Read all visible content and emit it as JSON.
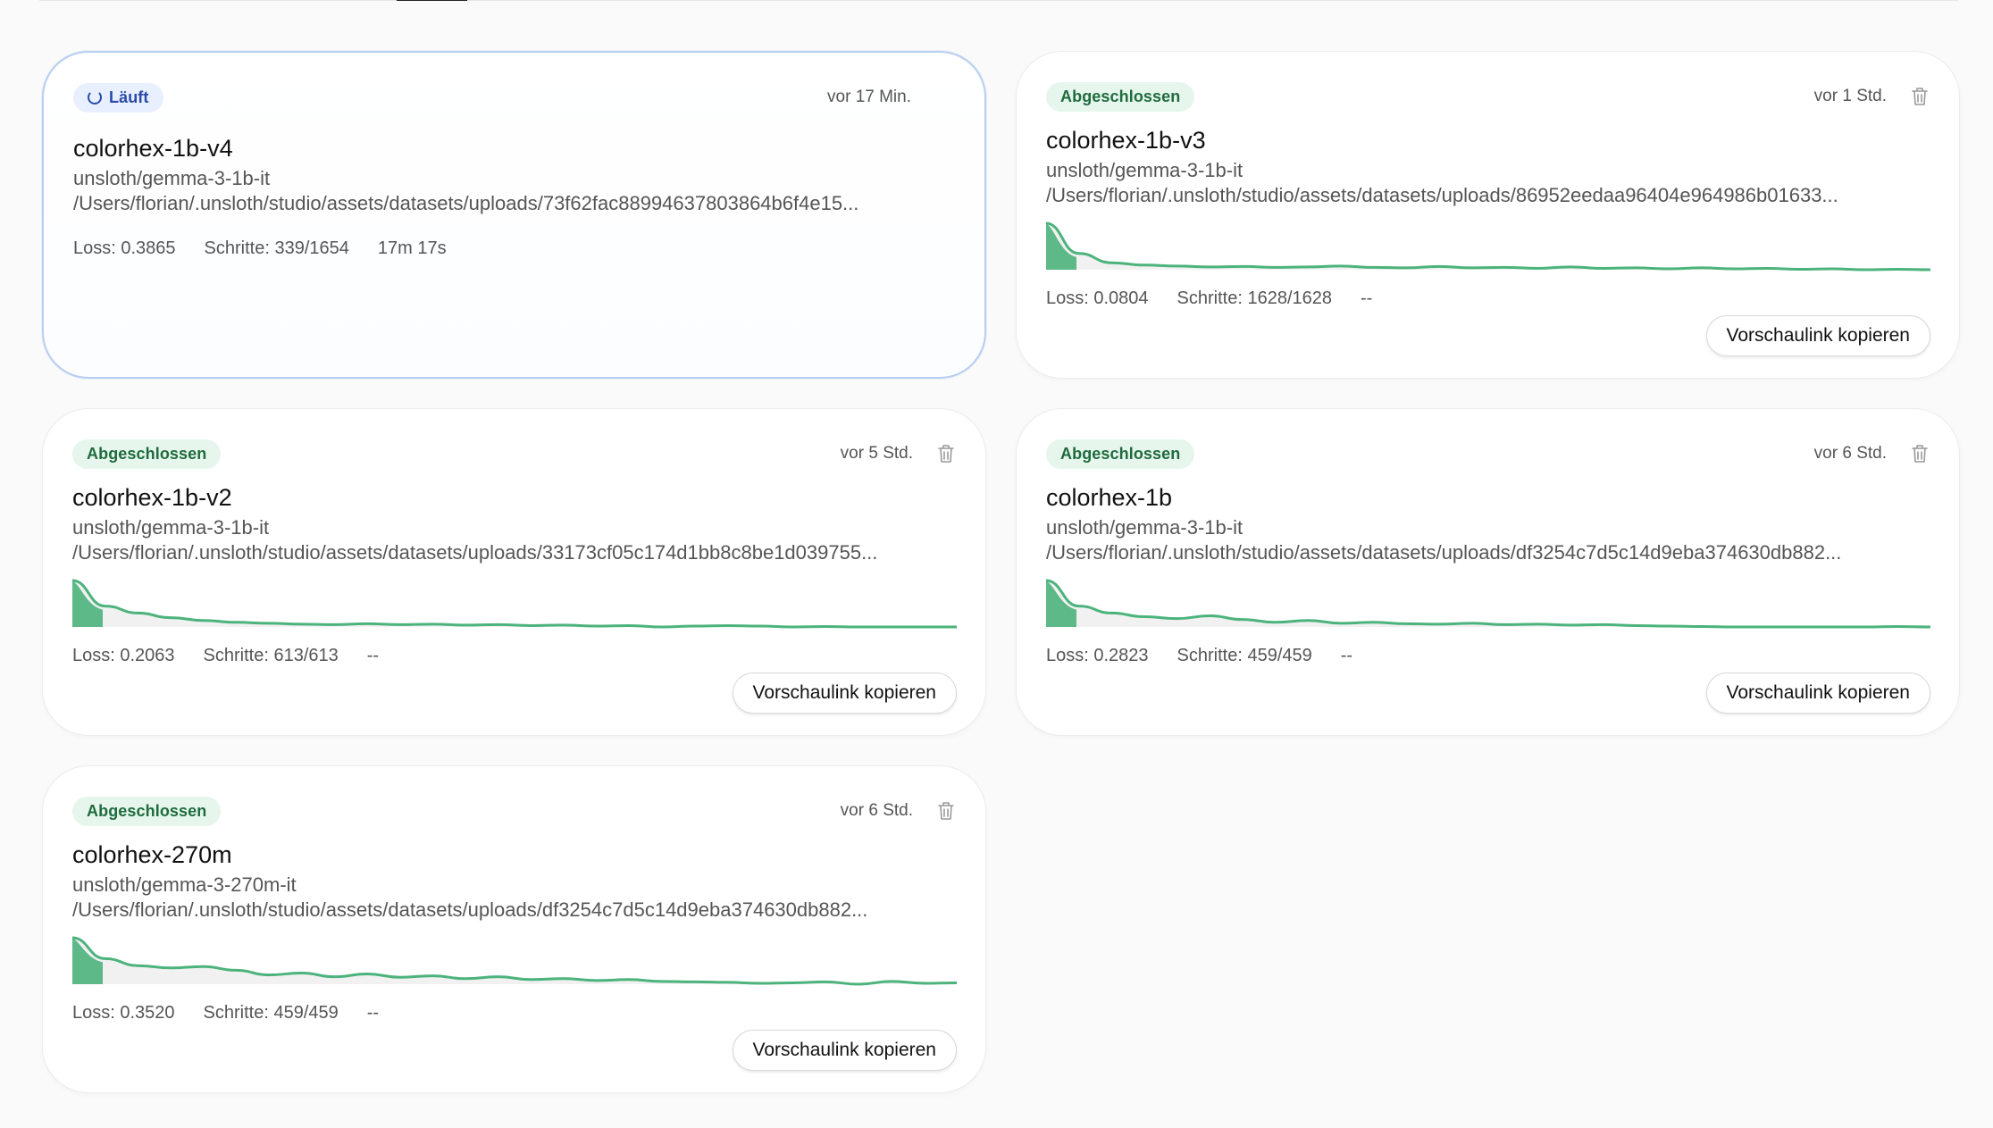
{
  "colors": {
    "accent_green": "#4cb37c",
    "badge_done_bg": "#e6f6ec",
    "badge_run_bg": "#e8efff",
    "running_border": "#b8cef0"
  },
  "labels": {
    "copy_button": "Vorschaulink kopieren",
    "loss_prefix": "Loss: ",
    "steps_prefix": "Schritte: "
  },
  "icons": {
    "trash": "trash-icon",
    "spinner": "spinner-icon"
  },
  "runs": [
    {
      "status": "Läuft",
      "time": "vor 17 Min.",
      "name": "colorhex-1b-v4",
      "model": "unsloth/gemma-3-1b-it",
      "dataset": "/Users/florian/.unsloth/studio/assets/datasets/uploads/73f62fac88994637803864b6f4e15...",
      "loss": "Loss: 0.3865",
      "steps": "Schritte: 339/1654",
      "duration": "17m 17s"
    },
    {
      "status": "Abgeschlossen",
      "time": "vor 1 Std.",
      "name": "colorhex-1b-v3",
      "model": "unsloth/gemma-3-1b-it",
      "dataset": "/Users/florian/.unsloth/studio/assets/datasets/uploads/86952eedaa96404e964986b01633...",
      "loss": "Loss: 0.0804",
      "steps": "Schritte: 1628/1628",
      "duration": "--",
      "loss_curve": [
        1.0,
        0.35,
        0.15,
        0.1,
        0.08,
        0.06,
        0.07,
        0.05,
        0.06,
        0.08,
        0.05,
        0.04,
        0.07,
        0.04,
        0.05,
        0.03,
        0.06,
        0.03,
        0.04,
        0.02,
        0.04,
        0.02,
        0.03,
        0.01,
        0.02,
        0.0,
        0.01,
        0.0
      ]
    },
    {
      "status": "Abgeschlossen",
      "time": "vor 5 Std.",
      "name": "colorhex-1b-v2",
      "model": "unsloth/gemma-3-1b-it",
      "dataset": "/Users/florian/.unsloth/studio/assets/datasets/uploads/33173cf05c174d1bb8c8be1d039755...",
      "loss": "Loss: 0.2063",
      "steps": "Schritte: 613/613",
      "duration": "--",
      "loss_curve": [
        1.0,
        0.45,
        0.3,
        0.2,
        0.14,
        0.1,
        0.08,
        0.06,
        0.05,
        0.07,
        0.05,
        0.06,
        0.04,
        0.05,
        0.03,
        0.04,
        0.02,
        0.03,
        0.0,
        0.02,
        0.03,
        0.02,
        0.0,
        0.01,
        0.0,
        0.0,
        0.0,
        0.0
      ]
    },
    {
      "status": "Abgeschlossen",
      "time": "vor 6 Std.",
      "name": "colorhex-1b",
      "model": "unsloth/gemma-3-1b-it",
      "dataset": "/Users/florian/.unsloth/studio/assets/datasets/uploads/df3254c7d5c14d9eba374630db882...",
      "loss": "Loss: 0.2823",
      "steps": "Schritte: 459/459",
      "duration": "--",
      "loss_curve": [
        1.0,
        0.45,
        0.3,
        0.22,
        0.18,
        0.24,
        0.16,
        0.1,
        0.14,
        0.08,
        0.1,
        0.07,
        0.06,
        0.08,
        0.05,
        0.06,
        0.04,
        0.05,
        0.03,
        0.02,
        0.01,
        0.0,
        0.0,
        0.0,
        0.0,
        0.0,
        0.01,
        0.0
      ]
    },
    {
      "status": "Abgeschlossen",
      "time": "vor 6 Std.",
      "name": "colorhex-270m",
      "model": "unsloth/gemma-3-270m-it",
      "dataset": "/Users/florian/.unsloth/studio/assets/datasets/uploads/df3254c7d5c14d9eba374630db882...",
      "loss": "Loss: 0.3520",
      "steps": "Schritte: 459/459",
      "duration": "--",
      "loss_curve": [
        1.0,
        0.55,
        0.4,
        0.35,
        0.38,
        0.3,
        0.2,
        0.24,
        0.16,
        0.22,
        0.15,
        0.18,
        0.12,
        0.16,
        0.1,
        0.12,
        0.08,
        0.1,
        0.06,
        0.05,
        0.04,
        0.02,
        0.03,
        0.05,
        0.0,
        0.06,
        0.02,
        0.03
      ]
    }
  ]
}
